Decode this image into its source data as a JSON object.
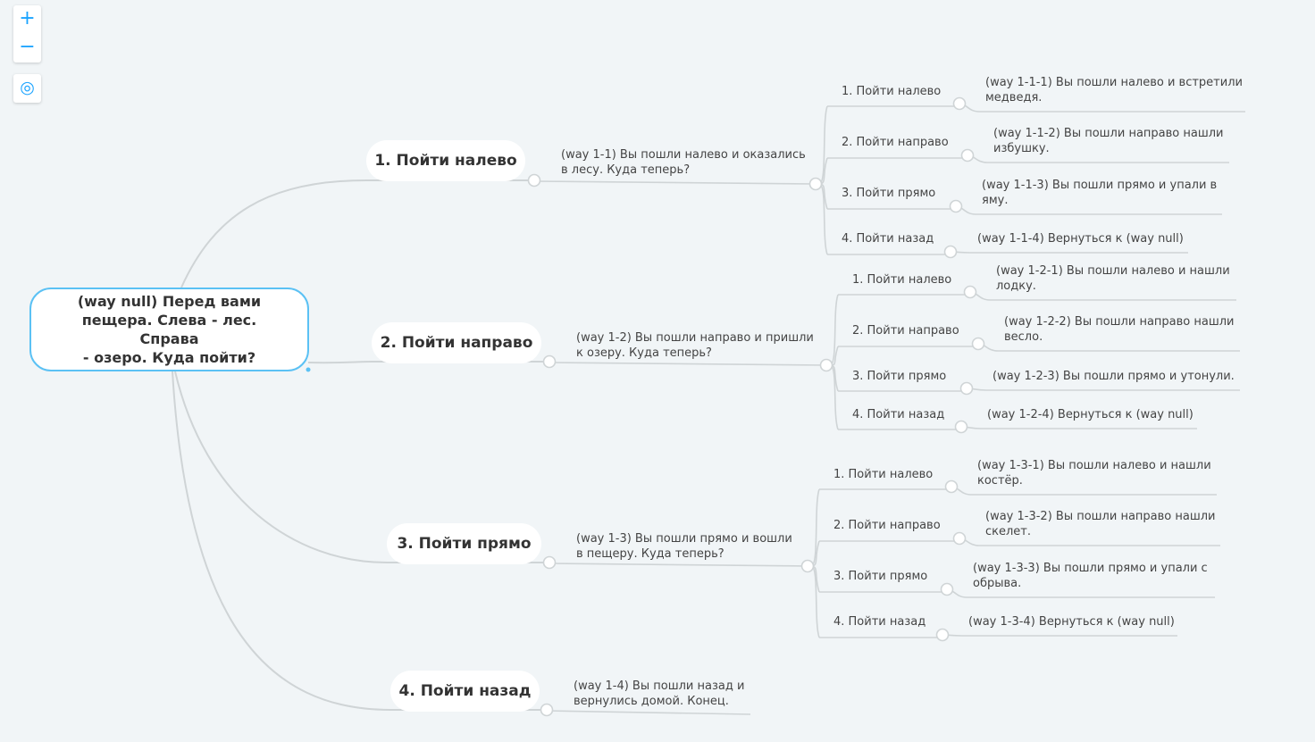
{
  "controls": {
    "zoom_in": "+",
    "zoom_out": "−",
    "center": "◎"
  },
  "root": {
    "lines": [
      "(way null) Перед вами",
      "пещера.  Слева - лес. Справа",
      "- озеро. Куда пойти?"
    ]
  },
  "branches": [
    {
      "label": "1. Пойти налево",
      "text": [
        "(way 1-1) Вы пошли налево и оказались",
        "в лесу. Куда теперь?"
      ],
      "options": [
        {
          "label": "1. Пойти налево",
          "text": [
            "(way 1-1-1) Вы пошли налево и встретили",
            "медведя."
          ]
        },
        {
          "label": "2. Пойти направо",
          "text": [
            "(way 1-1-2) Вы пошли направо нашли",
            "избушку."
          ]
        },
        {
          "label": "3. Пойти прямо",
          "text": [
            "(way 1-1-3) Вы пошли прямо и упали в",
            "яму."
          ]
        },
        {
          "label": "4. Пойти назад",
          "text": [
            "(way 1-1-4) Вернуться к (way null)"
          ]
        }
      ]
    },
    {
      "label": "2. Пойти направо",
      "text": [
        "(way 1-2) Вы пошли направо и пришли",
        "к озеру. Куда теперь?"
      ],
      "options": [
        {
          "label": "1. Пойти налево",
          "text": [
            "(way 1-2-1) Вы пошли налево и нашли",
            "лодку."
          ]
        },
        {
          "label": "2. Пойти направо",
          "text": [
            "(way 1-2-2) Вы пошли направо нашли",
            "весло."
          ]
        },
        {
          "label": "3. Пойти прямо",
          "text": [
            "(way 1-2-3) Вы пошли прямо и утонули."
          ]
        },
        {
          "label": "4. Пойти назад",
          "text": [
            "(way 1-2-4) Вернуться к (way null)"
          ]
        }
      ]
    },
    {
      "label": "3. Пойти прямо",
      "text": [
        "(way 1-3) Вы пошли прямо и вошли",
        "в пещеру. Куда теперь?"
      ],
      "options": [
        {
          "label": "1. Пойти налево",
          "text": [
            "(way 1-3-1) Вы пошли налево и нашли",
            "костёр."
          ]
        },
        {
          "label": "2. Пойти направо",
          "text": [
            "(way 1-3-2) Вы пошли направо нашли",
            "скелет."
          ]
        },
        {
          "label": "3. Пойти прямо",
          "text": [
            "(way 1-3-3) Вы пошли прямо и упали с",
            "обрыва."
          ]
        },
        {
          "label": "4. Пойти назад",
          "text": [
            "(way 1-3-4) Вернуться к (way null)"
          ]
        }
      ]
    },
    {
      "label": "4. Пойти назад",
      "text": [
        "(way 1-4) Вы пошли назад и",
        "вернулись домой. Конец."
      ],
      "options": []
    }
  ],
  "colors": {
    "background": "#f1f5f7",
    "line": "#cfd4d6",
    "accent": "#1aa3ff",
    "root_border": "#5bc1f4"
  }
}
